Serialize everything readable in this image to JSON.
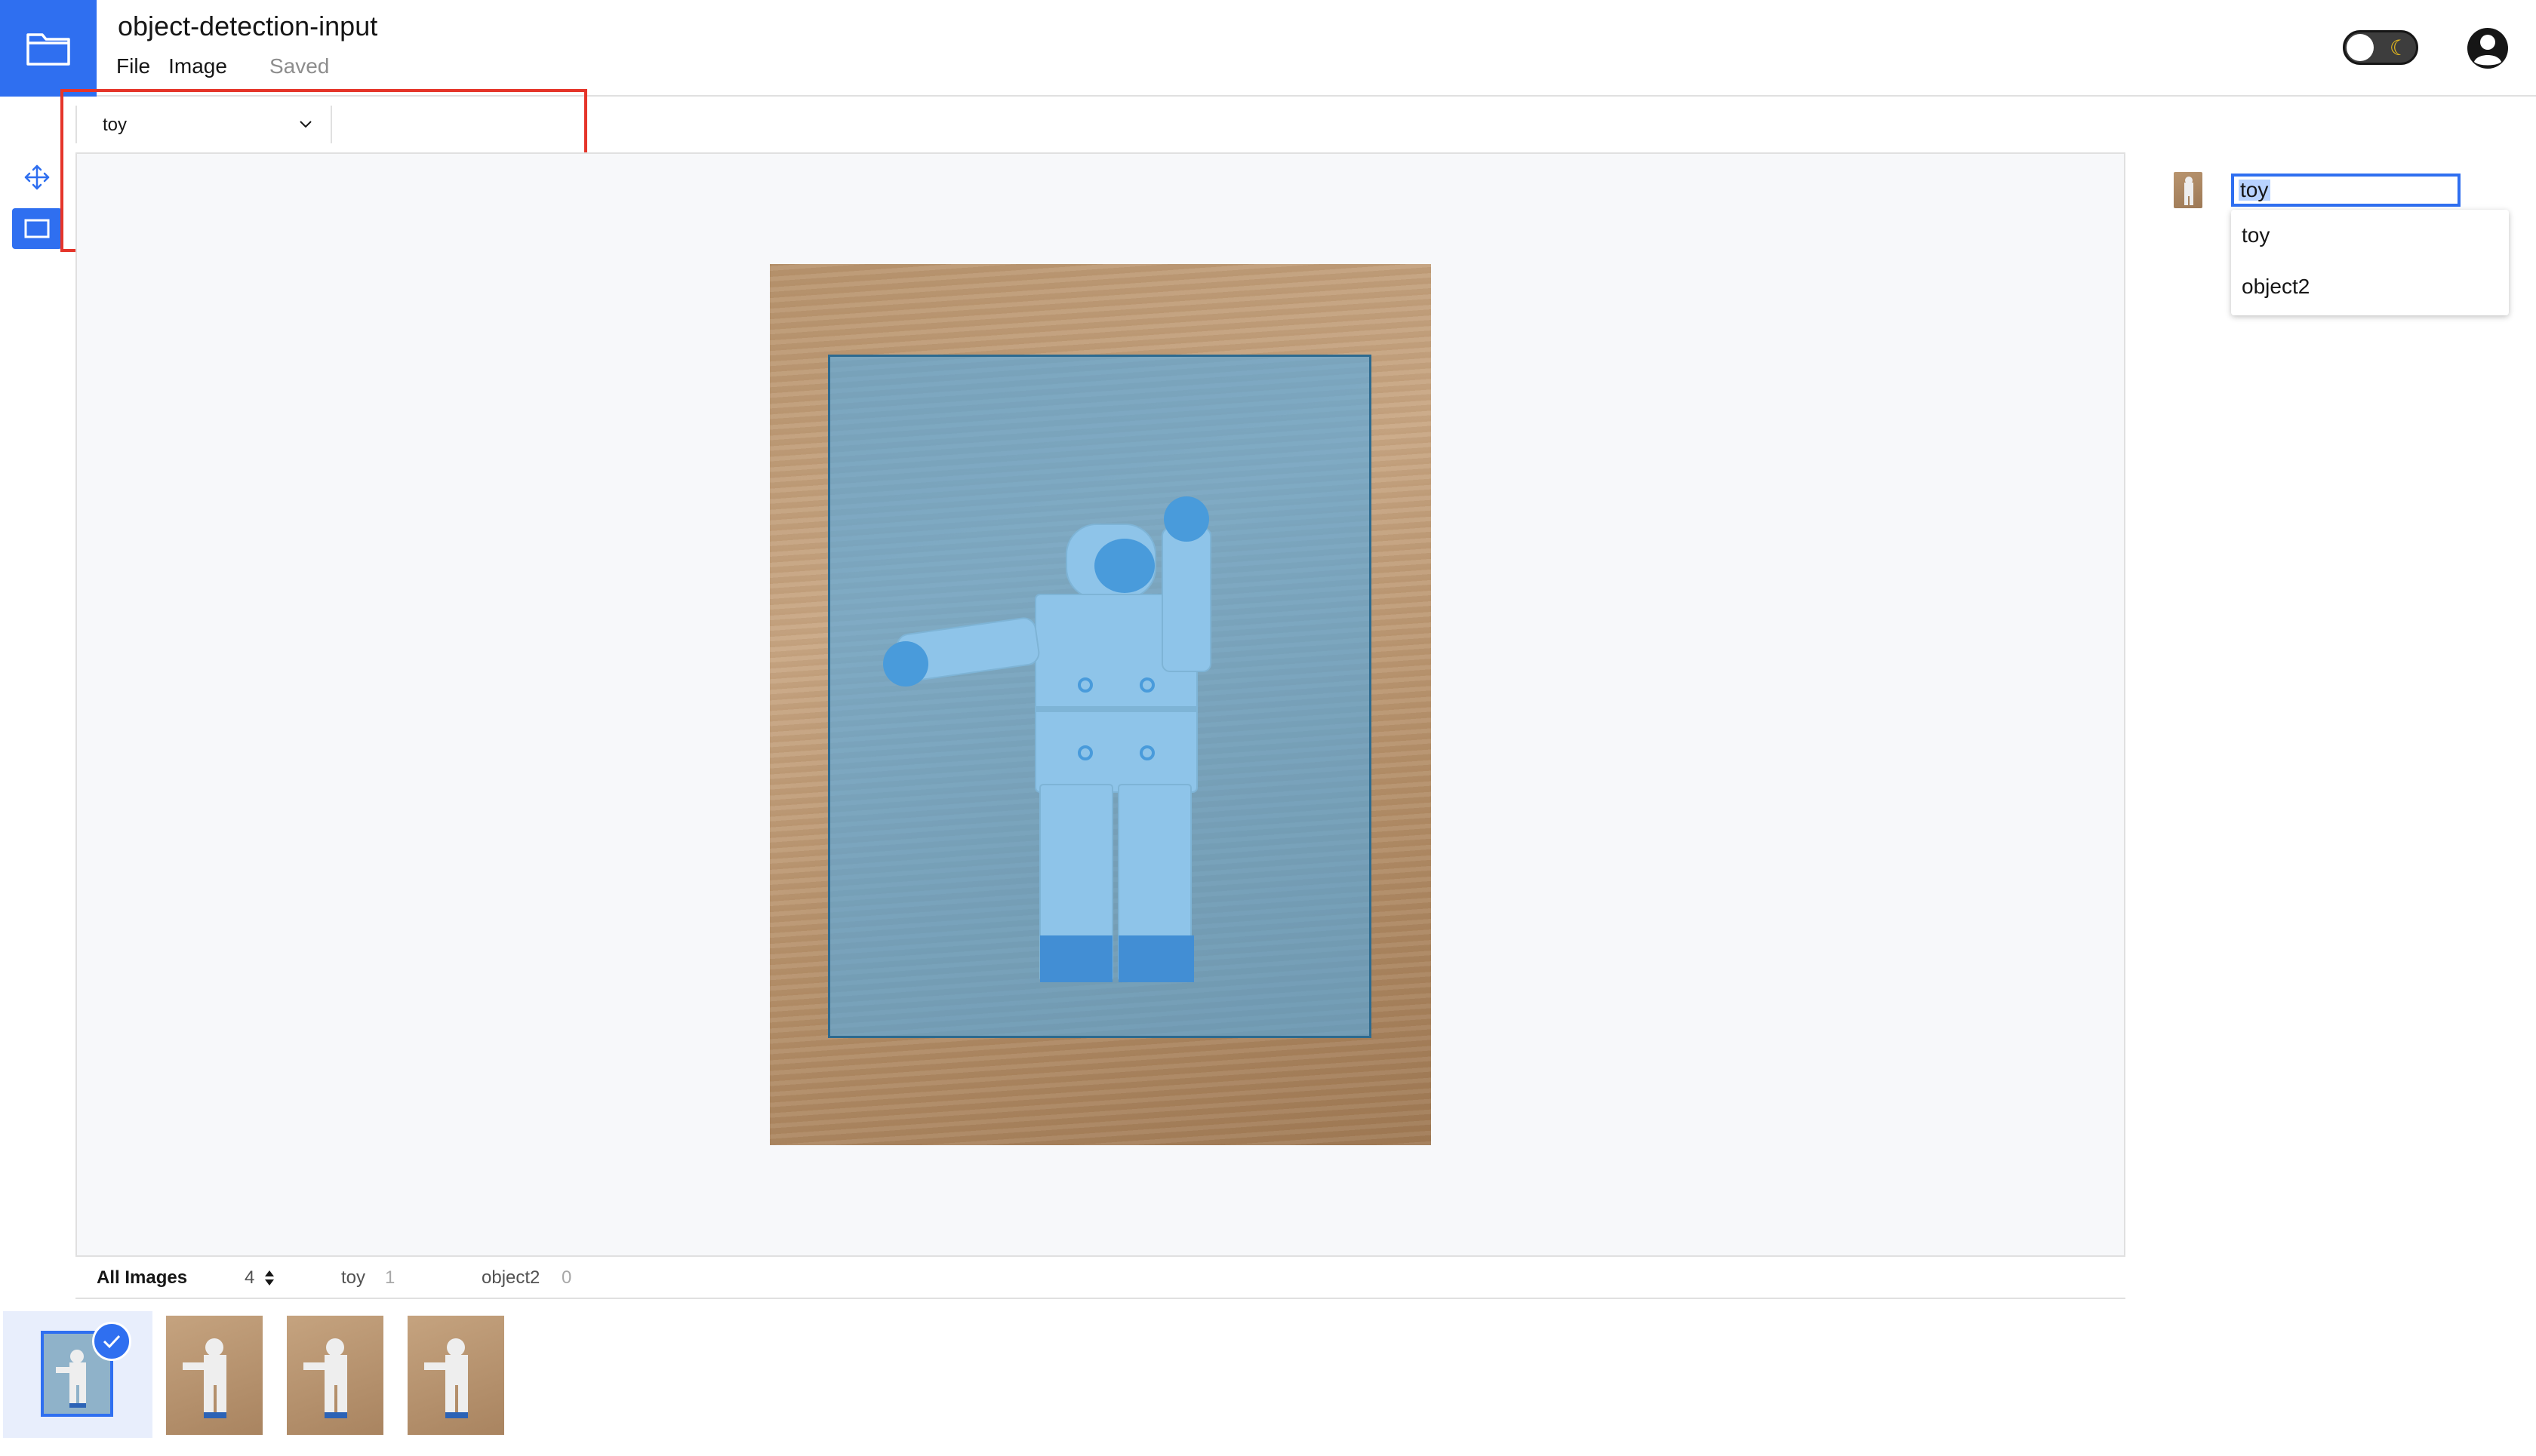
{
  "header": {
    "title": "object-detection-input",
    "menu": {
      "file": "File",
      "image": "Image"
    },
    "status": "Saved"
  },
  "toolbar": {
    "label_selected": "toy"
  },
  "annotation_panel": {
    "label_value": "toy",
    "options": [
      "toy",
      "object2"
    ]
  },
  "filter_bar": {
    "all_images_label": "All Images",
    "all_images_count": "4",
    "labels": [
      {
        "name": "toy",
        "count": "1"
      },
      {
        "name": "object2",
        "count": "0"
      }
    ]
  },
  "colors": {
    "accent": "#2f6ff0",
    "highlight": "#e5352a",
    "bbox_fill": "#50aae6"
  },
  "icons": [
    "folder-icon",
    "moon-icon",
    "user-icon",
    "move-icon",
    "bounding-box-icon",
    "chevron-down-icon",
    "checkmark-icon",
    "sort-icon"
  ]
}
